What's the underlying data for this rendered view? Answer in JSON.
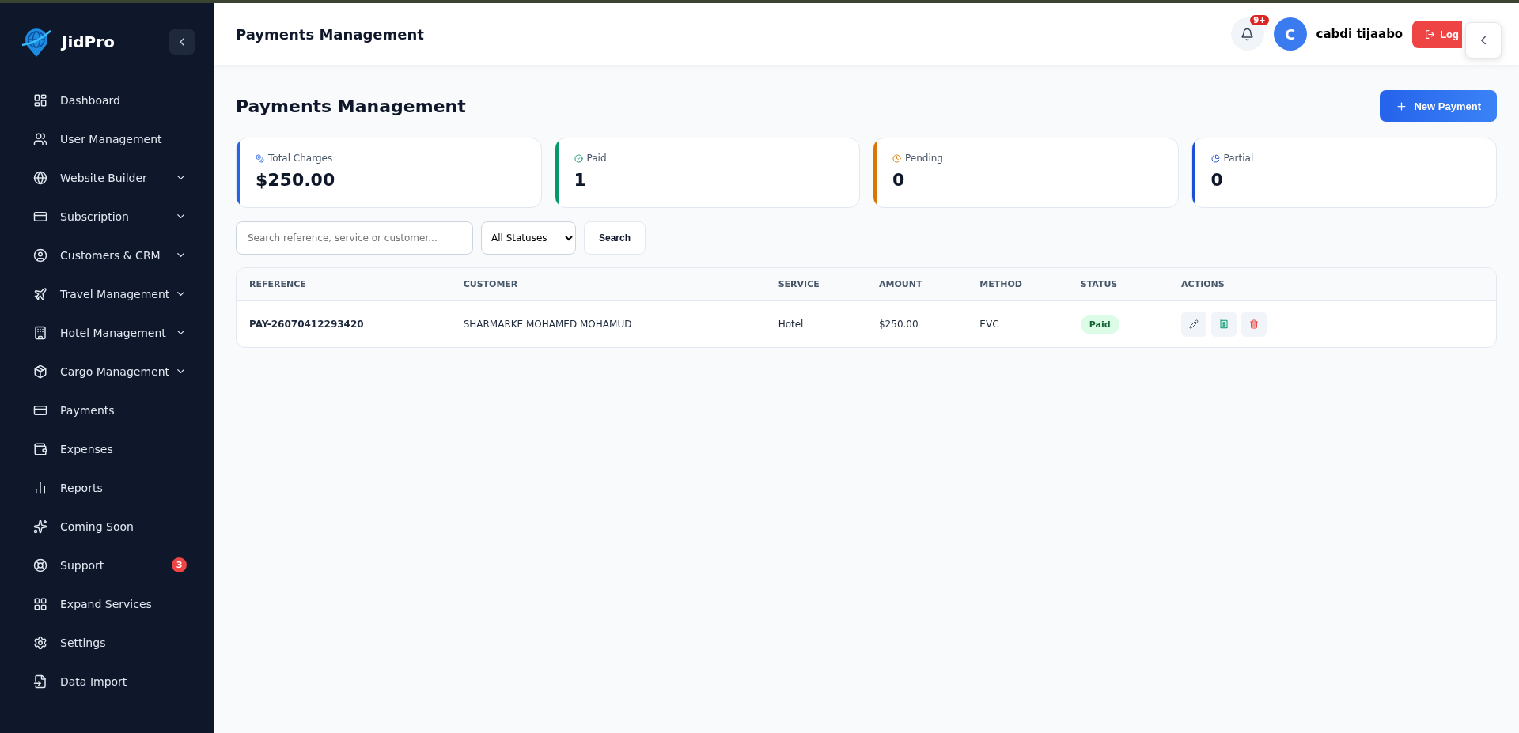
{
  "brand": {
    "name": "JidPro"
  },
  "sidebar": {
    "items": [
      {
        "label": "Dashboard",
        "collapsible": false
      },
      {
        "label": "User Management",
        "collapsible": false
      },
      {
        "label": "Website Builder",
        "collapsible": true
      },
      {
        "label": "Subscription",
        "collapsible": true
      },
      {
        "label": "Customers & CRM",
        "collapsible": true
      },
      {
        "label": "Travel Management",
        "collapsible": true
      },
      {
        "label": "Hotel Management",
        "collapsible": true
      },
      {
        "label": "Cargo Management",
        "collapsible": true
      },
      {
        "label": "Payments",
        "collapsible": false
      },
      {
        "label": "Expenses",
        "collapsible": false
      },
      {
        "label": "Reports",
        "collapsible": false
      },
      {
        "label": "Coming Soon",
        "collapsible": false
      },
      {
        "label": "Support",
        "collapsible": false,
        "badge": "3"
      },
      {
        "label": "Expand Services",
        "collapsible": false
      },
      {
        "label": "Settings",
        "collapsible": false
      },
      {
        "label": "Data Import",
        "collapsible": false
      }
    ]
  },
  "header": {
    "title": "Payments Management",
    "notification_badge": "9+",
    "avatar_initial": "C",
    "user_name": "cabdi tijaabo",
    "logout_label": "Log"
  },
  "page": {
    "title": "Payments Management",
    "new_button": "New Payment"
  },
  "stats": [
    {
      "label": "Total Charges",
      "value": "$250.00",
      "color": "#2563eb"
    },
    {
      "label": "Paid",
      "value": "1",
      "color": "#059669"
    },
    {
      "label": "Pending",
      "value": "0",
      "color": "#d97706"
    },
    {
      "label": "Partial",
      "value": "0",
      "color": "#1d4ed8"
    }
  ],
  "filters": {
    "search_placeholder": "Search reference, service or customer...",
    "status_value": "All Statuses",
    "search_button": "Search"
  },
  "table": {
    "columns": [
      "REFERENCE",
      "CUSTOMER",
      "SERVICE",
      "AMOUNT",
      "METHOD",
      "STATUS",
      "ACTIONS"
    ],
    "rows": [
      {
        "reference": "PAY-26070412293420",
        "customer": "SHARMARKE MOHAMED MOHAMUD",
        "service": "Hotel",
        "amount": "$250.00",
        "method": "EVC",
        "status": "Paid"
      }
    ]
  }
}
